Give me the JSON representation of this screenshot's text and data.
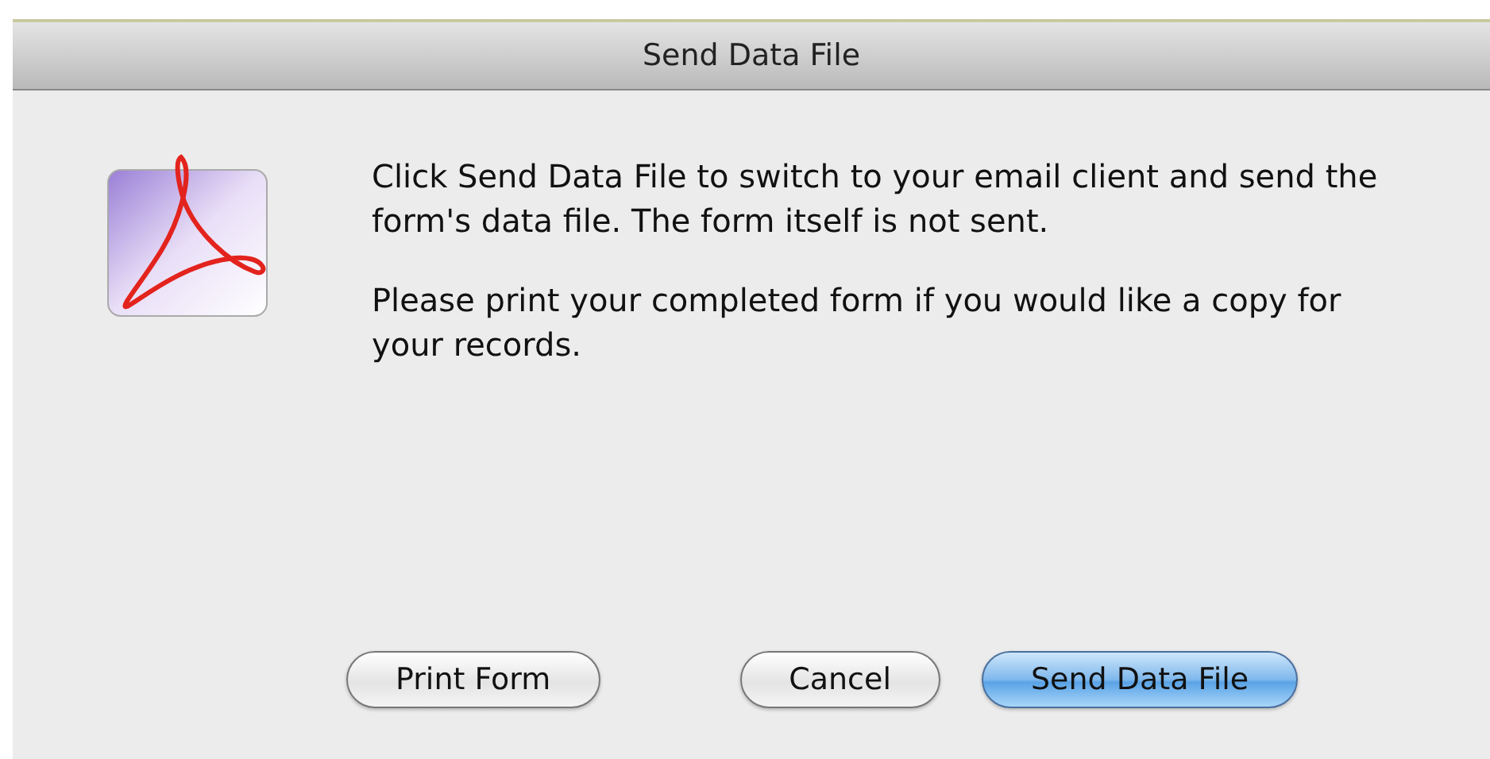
{
  "window": {
    "title": "Send Data File"
  },
  "message": [
    "Click Send Data File to switch to your email client and send the form's data file.  The form itself is not sent.",
    "Please print your completed form if you would like a copy for your records."
  ],
  "buttons": [
    {
      "label": "Print Form",
      "default": false
    },
    {
      "label": "Cancel",
      "default": false
    },
    {
      "label": "Send Data File",
      "default": true
    }
  ]
}
